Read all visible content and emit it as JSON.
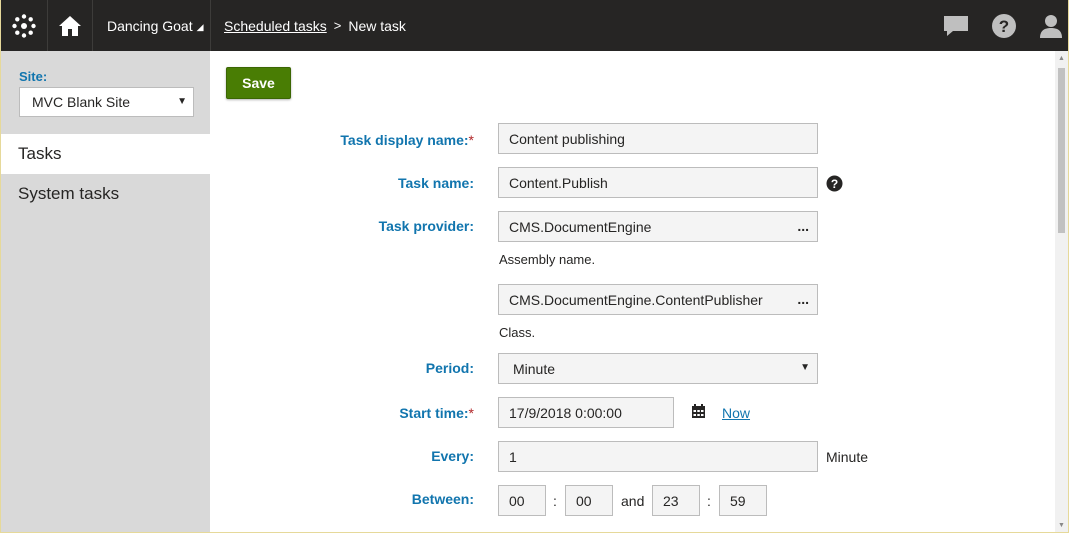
{
  "header": {
    "logo_icon": "kentico-logo-icon",
    "home_icon": "home-icon",
    "site_name": "Dancing Goat",
    "breadcrumbs": {
      "parent": "Scheduled tasks",
      "separator": ">",
      "current": "New task"
    },
    "right_icons": [
      "chat-icon",
      "help-icon",
      "user-icon"
    ]
  },
  "sidebar": {
    "site_label": "Site:",
    "site_value": "MVC Blank Site",
    "items": [
      {
        "label": "Tasks",
        "selected": true
      },
      {
        "label": "System tasks",
        "selected": false
      }
    ]
  },
  "form": {
    "save_label": "Save",
    "display_name": {
      "label": "Task display name:",
      "required": "*",
      "value": "Content publishing"
    },
    "task_name": {
      "label": "Task name:",
      "value": "Content.Publish"
    },
    "provider": {
      "label": "Task provider:",
      "assembly_value": "CMS.DocumentEngine",
      "assembly_hint": "Assembly name.",
      "class_value": "CMS.DocumentEngine.ContentPublisher",
      "class_hint": "Class.",
      "dots": "..."
    },
    "period": {
      "label": "Period:",
      "value": "Minute"
    },
    "start_time": {
      "label": "Start time:",
      "required": "*",
      "value": "17/9/2018 0:00:00",
      "now_link": "Now"
    },
    "every": {
      "label": "Every:",
      "value": "1",
      "unit": "Minute"
    },
    "between": {
      "label": "Between:",
      "from_h": "00",
      "from_m": "00",
      "and": "and",
      "to_h": "23",
      "to_m": "59",
      "colon": ":"
    }
  },
  "colors": {
    "header_bg": "#262524",
    "label_blue": "#1175ae",
    "save_green": "#497d04",
    "required_red": "#b12628"
  }
}
